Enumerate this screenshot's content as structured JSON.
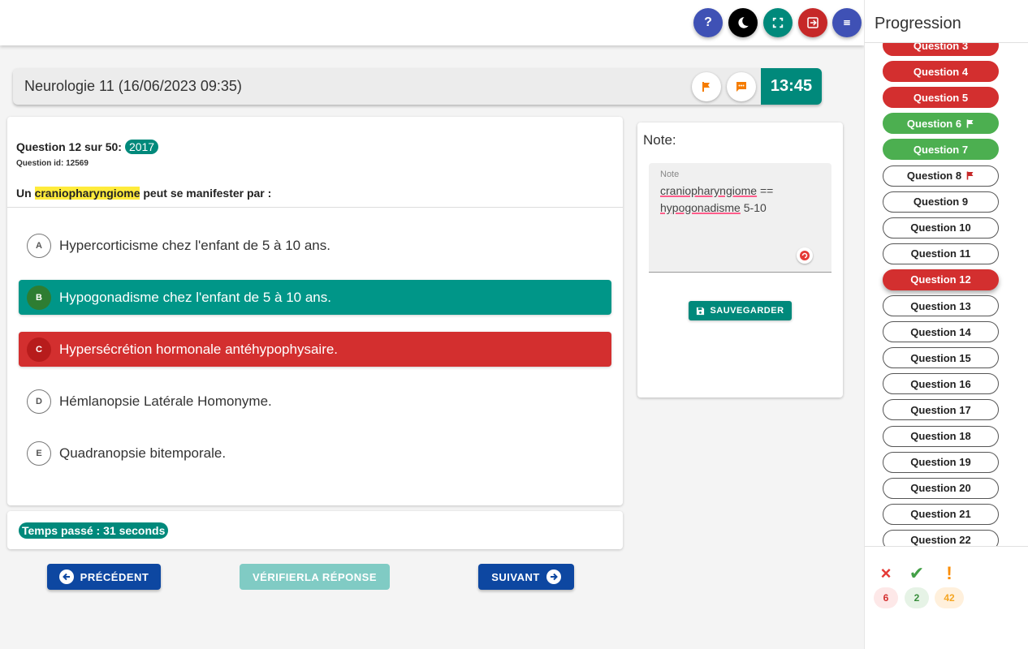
{
  "toolbar": {
    "help_label": "?",
    "colors": {
      "help": "#3f51b5",
      "theme": "#000000",
      "fullscreen": "#00897b",
      "exit": "#c62828",
      "menu": "#3f51b5"
    }
  },
  "header": {
    "exam_title": "Neurologie 11 (16/06/2023 09:35)",
    "timer": "13:45"
  },
  "question": {
    "number_label": "Question 12 sur 50:",
    "year": "2017",
    "id_label": "Question id: 12569",
    "stem_prefix": "Un ",
    "stem_highlight": "craniopharyngiome",
    "stem_suffix": " peut se manifester par :",
    "options": [
      {
        "letter": "A",
        "text": "Hypercorticisme chez l'enfant de 5 à 10 ans.",
        "state": "neutral"
      },
      {
        "letter": "B",
        "text": "Hypogonadisme chez l'enfant de 5 à 10 ans.",
        "state": "correct"
      },
      {
        "letter": "C",
        "text": "Hypersécrétion hormonale antéhypophysaire.",
        "state": "wrong"
      },
      {
        "letter": "D",
        "text": "Hémlanopsie Latérale Homonyme.",
        "state": "neutral"
      },
      {
        "letter": "E",
        "text": "Quadranopsie bitemporale.",
        "state": "neutral"
      }
    ]
  },
  "time_spent": "Temps passé : 31 seconds",
  "nav": {
    "prev_label": "PRÉCÉDENT",
    "verify_label": "VÉRIFIERLA RÉPONSE",
    "next_label": "SUIVANT"
  },
  "note": {
    "title": "Note:",
    "field_label": "Note",
    "line1_word": "craniopharyngiome",
    "line1_rest": " ==",
    "line2_word": "hypogonadisme",
    "line2_rest": " 5-10",
    "save_label": "SAUVEGARDER"
  },
  "sidebar": {
    "title": "Progression",
    "questions": [
      {
        "label": "Question 3",
        "state": "red",
        "flag": false
      },
      {
        "label": "Question 4",
        "state": "red",
        "flag": false
      },
      {
        "label": "Question 5",
        "state": "red",
        "flag": false
      },
      {
        "label": "Question 6",
        "state": "green",
        "flag": true
      },
      {
        "label": "Question 7",
        "state": "green",
        "flag": false
      },
      {
        "label": "Question 8",
        "state": "outline",
        "flag": true
      },
      {
        "label": "Question 9",
        "state": "outline",
        "flag": false
      },
      {
        "label": "Question 10",
        "state": "outline",
        "flag": false
      },
      {
        "label": "Question 11",
        "state": "outline",
        "flag": false
      },
      {
        "label": "Question 12",
        "state": "current",
        "flag": false
      },
      {
        "label": "Question 13",
        "state": "outline",
        "flag": false
      },
      {
        "label": "Question 14",
        "state": "outline",
        "flag": false
      },
      {
        "label": "Question 15",
        "state": "outline",
        "flag": false
      },
      {
        "label": "Question 16",
        "state": "outline",
        "flag": false
      },
      {
        "label": "Question 17",
        "state": "outline",
        "flag": false
      },
      {
        "label": "Question 18",
        "state": "outline",
        "flag": false
      },
      {
        "label": "Question 19",
        "state": "outline",
        "flag": false
      },
      {
        "label": "Question 20",
        "state": "outline",
        "flag": false
      },
      {
        "label": "Question 21",
        "state": "outline",
        "flag": false
      },
      {
        "label": "Question 22",
        "state": "outline",
        "flag": false
      }
    ],
    "stats": {
      "wrong_icon": "×",
      "wrong_count": "6",
      "correct_icon": "✔",
      "correct_count": "2",
      "pending_icon": "!",
      "pending_count": "42"
    }
  }
}
